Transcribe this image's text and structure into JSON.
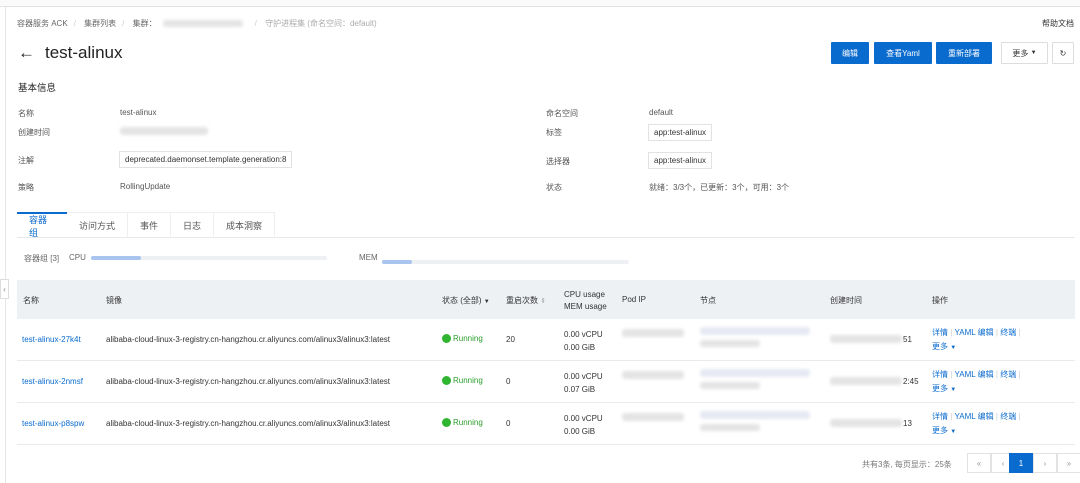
{
  "breadcrumb": {
    "items": [
      "容器服务 ACK",
      "集群列表",
      "集群：",
      "守护进程集 (命名空间：default)"
    ]
  },
  "help": "帮助文档",
  "title": "test-alinux",
  "buttons": {
    "edit": "编辑",
    "yaml": "查看Yaml",
    "redeploy": "重新部署",
    "more": "更多",
    "refresh": "↻"
  },
  "basic": {
    "heading": "基本信息",
    "name_label": "名称",
    "name": "test-alinux",
    "created_label": "创建时间",
    "annotation_label": "注解",
    "annotation": "deprecated.daemonset.template.generation:8",
    "strategy_label": "策略",
    "strategy": "RollingUpdate",
    "namespace_label": "命名空间",
    "namespace": "default",
    "labels_label": "标签",
    "labels": "app:test-alinux",
    "selector_label": "选择器",
    "selector": "app:test-alinux",
    "status_label": "状态",
    "status": "就绪：3/3个，已更新：3个，可用：3个"
  },
  "tabs": [
    "容器组",
    "访问方式",
    "事件",
    "日志",
    "成本洞察"
  ],
  "usage": {
    "label": "容器组 [3]",
    "cpu_label": "CPU",
    "cpu_fraction": 0.21,
    "mem_label": "MEM",
    "mem_fraction": 0.12
  },
  "table": {
    "headers": {
      "name": "名称",
      "image": "镜像",
      "status": "状态 (全部)",
      "restarts": "重启次数",
      "usage1": "CPU usage",
      "usage2": "MEM usage",
      "podip": "Pod IP",
      "node": "节点",
      "created": "创建时间",
      "ops": "操作"
    },
    "rows": [
      {
        "name": "test-alinux-27k4t",
        "image": "alibaba-cloud-linux-3-registry.cn-hangzhou.cr.aliyuncs.com/alinux3/alinux3:latest",
        "status": "Running",
        "restarts": "20",
        "cpu": "0.00 vCPU",
        "mem": "0.00 GiB",
        "created_tail": "51"
      },
      {
        "name": "test-alinux-2nmsf",
        "image": "alibaba-cloud-linux-3-registry.cn-hangzhou.cr.aliyuncs.com/alinux3/alinux3:latest",
        "status": "Running",
        "restarts": "0",
        "cpu": "0.00 vCPU",
        "mem": "0.07 GiB",
        "created_tail": "2:45"
      },
      {
        "name": "test-alinux-p8spw",
        "image": "alibaba-cloud-linux-3-registry.cn-hangzhou.cr.aliyuncs.com/alinux3/alinux3:latest",
        "status": "Running",
        "restarts": "0",
        "cpu": "0.00 vCPU",
        "mem": "0.00 GiB",
        "created_tail": "13"
      }
    ],
    "ops": {
      "detail": "详情",
      "yaml": "YAML 编辑",
      "terminal": "终端",
      "more": "更多"
    }
  },
  "pagination": {
    "summary": "共有3条, 每页显示：25条",
    "first": "«",
    "prev": "‹",
    "current": "1",
    "next": "›",
    "last": "»"
  }
}
